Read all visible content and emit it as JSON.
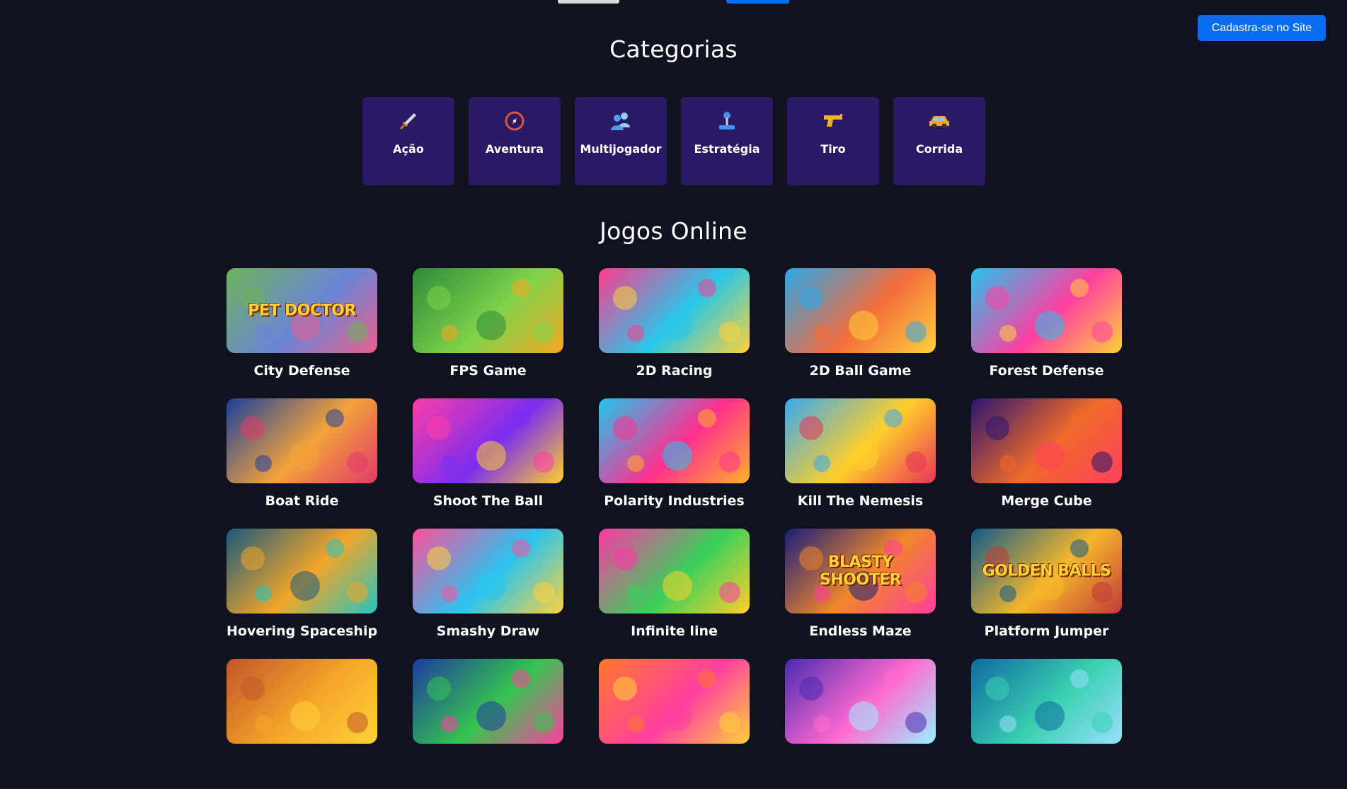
{
  "header": {
    "signup_label": "Cadastra-se no Site"
  },
  "categories_section": {
    "title": "Categorias",
    "items": [
      {
        "label": "Ação",
        "icon": "sword-icon"
      },
      {
        "label": "Aventura",
        "icon": "compass-icon"
      },
      {
        "label": "Multijogador",
        "icon": "users-icon"
      },
      {
        "label": "Estratégia",
        "icon": "joystick-icon"
      },
      {
        "label": "Tiro",
        "icon": "gun-icon"
      },
      {
        "label": "Corrida",
        "icon": "car-icon"
      }
    ]
  },
  "games_section": {
    "title": "Jogos Online",
    "games": [
      {
        "name": "City Defense",
        "thumb_text": "PET DOCTOR",
        "colors": [
          "#6fb35a",
          "#6a85d8",
          "#e95f8a"
        ]
      },
      {
        "name": "FPS Game",
        "thumb_text": "",
        "colors": [
          "#2d8a3a",
          "#7fd34a",
          "#f5a623"
        ]
      },
      {
        "name": "2D Racing",
        "thumb_text": "",
        "colors": [
          "#ff3b8d",
          "#28c7e8",
          "#ffd23a"
        ]
      },
      {
        "name": "2D Ball Game",
        "thumb_text": "",
        "colors": [
          "#2aa7e8",
          "#f26d3d",
          "#ffd23a"
        ]
      },
      {
        "name": "Forest Defense",
        "thumb_text": "",
        "colors": [
          "#25c4ef",
          "#ff3fa0",
          "#ffd23a"
        ]
      },
      {
        "name": "Boat Ride",
        "thumb_text": "",
        "colors": [
          "#1b3f9c",
          "#f2a23a",
          "#e23a6a"
        ]
      },
      {
        "name": "Shoot The Ball",
        "thumb_text": "",
        "colors": [
          "#ff3da6",
          "#7a2df0",
          "#ffcf2a"
        ]
      },
      {
        "name": "Polarity Industries",
        "thumb_text": "",
        "colors": [
          "#1fc8f0",
          "#ff2f8e",
          "#ffb12a"
        ]
      },
      {
        "name": "Kill The Nemesis",
        "thumb_text": "",
        "colors": [
          "#38a8f0",
          "#ffcf2a",
          "#e8335a"
        ]
      },
      {
        "name": "Merge Cube",
        "thumb_text": "",
        "colors": [
          "#2a1470",
          "#f06a2a",
          "#ff3f5e"
        ]
      },
      {
        "name": "Hovering Spaceship",
        "thumb_text": "",
        "colors": [
          "#1a5a7a",
          "#f2a52a",
          "#25c4c0"
        ]
      },
      {
        "name": "Smashy Draw",
        "thumb_text": "",
        "colors": [
          "#ff4f9a",
          "#2ac4ef",
          "#ffd23a"
        ]
      },
      {
        "name": "Infinite line",
        "thumb_text": "",
        "colors": [
          "#ff36a8",
          "#3ad05a",
          "#ffcf2a"
        ]
      },
      {
        "name": "Endless Maze",
        "thumb_text": "BLASTY SHOOTER",
        "colors": [
          "#1a1e7a",
          "#f0872a",
          "#ff3da0"
        ]
      },
      {
        "name": "Platform Jumper",
        "thumb_text": "GOLDEN BALLS",
        "colors": [
          "#0f5a8a",
          "#f5b72a",
          "#c23a3a"
        ]
      },
      {
        "name": "",
        "thumb_text": "",
        "colors": [
          "#c2552a",
          "#f5a62a",
          "#ffd23a"
        ]
      },
      {
        "name": "",
        "thumb_text": "",
        "colors": [
          "#1d3aa0",
          "#35c450",
          "#ff3fa0"
        ]
      },
      {
        "name": "",
        "thumb_text": "",
        "colors": [
          "#ff7a2a",
          "#ff3fa0",
          "#ffd23a"
        ]
      },
      {
        "name": "",
        "thumb_text": "",
        "colors": [
          "#4a2ab0",
          "#ff6ad0",
          "#9af0ff"
        ]
      },
      {
        "name": "",
        "thumb_text": "",
        "colors": [
          "#0f6aa0",
          "#3ad0b0",
          "#9ae0ff"
        ]
      }
    ]
  }
}
